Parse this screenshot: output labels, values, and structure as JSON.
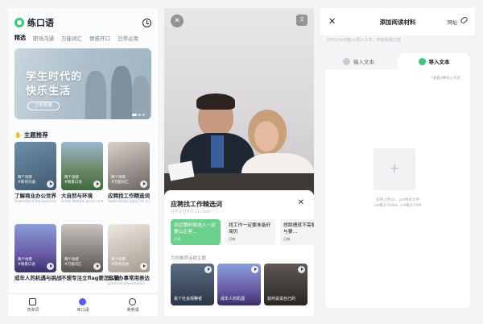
{
  "panel1": {
    "app_title": "练口语",
    "tabs": [
      "精选",
      "职场沟通",
      "万能词汇",
      "情感开口",
      "日常必用"
    ],
    "banner": {
      "line1": "学生时代的",
      "line2": "快乐生活",
      "button": "立即观看"
    },
    "section_title": "主题推荐",
    "cards": [
      {
        "title": "了解商业办公世界",
        "sub": "Understand the business world",
        "tag1": "两个场景",
        "tag2": "#职场沟通"
      },
      {
        "title": "大自然与环境",
        "sub": "Green Nature, green matter",
        "tag1": "两个场景",
        "tag2": "#情景口语"
      },
      {
        "title": "应聘找工作精选词",
        "sub": "Applications apply for a job",
        "tag1": "两个场景",
        "tag2": "#万能词汇"
      },
      {
        "title": "成年人的机遇与挑战",
        "sub": "",
        "tag1": "两个场景",
        "tag2": "#情景口语"
      },
      {
        "title": "不想专注立flag要怎么说",
        "sub": "",
        "tag1": "两个场景",
        "tag2": "#万能词汇"
      },
      {
        "title": "日常办事常用表达",
        "sub": "personal presentation",
        "tag1": "两个场景",
        "tag2": "#职场沟通"
      }
    ],
    "nav": [
      "背单词",
      "练口语",
      "英英语"
    ]
  },
  "panel2": {
    "sheet_title": "应聘找工作精选词",
    "sheet_sub": "已学习 已学习 21 / 100",
    "phrases": [
      {
        "text": "对应聘的候选人一定要公正客…",
        "meta": "已听"
      },
      {
        "text": "找工作一定要准备好简历",
        "meta": "已听"
      },
      {
        "text": "想跳槽就不需要与要…",
        "meta": "已听"
      }
    ],
    "section": "为你推荐话题主题",
    "videos": [
      "看个社会观察者",
      "成年人的机遇",
      "如何说说自己的"
    ]
  },
  "panel3": {
    "title": "添加阅读材料",
    "url_label": "网址",
    "hint": "你可以手动输入/导入文本，开启阅读之旅",
    "tab_input": "输入文本",
    "tab_import": "导入文本",
    "formats": "*查看3种导入方式",
    "upload_hint1": "支持上传txt、pdf格式文件",
    "upload_hint2": "txt最大500kb, pdf最大10M"
  },
  "colors": {
    "accent_green": "#3ec97a",
    "phrase_green": "#6cd08d",
    "nav_active": "#5a5cf0"
  }
}
